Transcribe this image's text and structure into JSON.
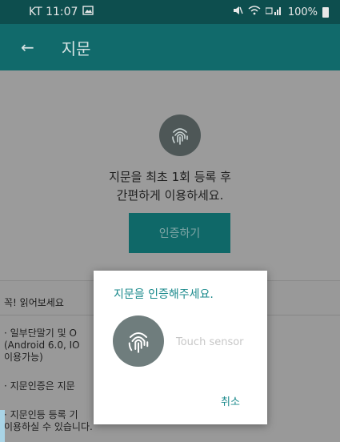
{
  "status_bar": {
    "carrier_time": "KT 11:07",
    "right_icons": "❄ ☷",
    "battery_percent": "100%"
  },
  "app_bar": {
    "back_icon": "←",
    "title": "지문"
  },
  "main": {
    "intro_line1": "지문을 최초 1회 등록 후",
    "intro_line2": "간편하게 이용하세요.",
    "auth_button": "인증하기"
  },
  "notice": {
    "title": "꼭! 읽어보세요",
    "item1_line1": "· 일부단말기 및 O",
    "item1_line2": "(Android 6.0, IO",
    "item1_line3": "이용가능)",
    "item2": "· 지문인증은 지문",
    "item3_line1": "· 지문인등 등록 기",
    "item3_line2": "이용하실 수 있습니다."
  },
  "dialog": {
    "title": "지문을 인증해주세요.",
    "sensor_text": "Touch sensor",
    "cancel": "취소"
  },
  "icons": {
    "back": "back-arrow-icon",
    "fingerprint": "fingerprint-icon",
    "gallery": "gallery-icon",
    "battery": "battery-icon"
  },
  "colors": {
    "status_bar": "#0d4e4e",
    "app_bar": "#116a6b",
    "accent": "#1b8a8c",
    "overlay_background": "#9b9b9b"
  }
}
